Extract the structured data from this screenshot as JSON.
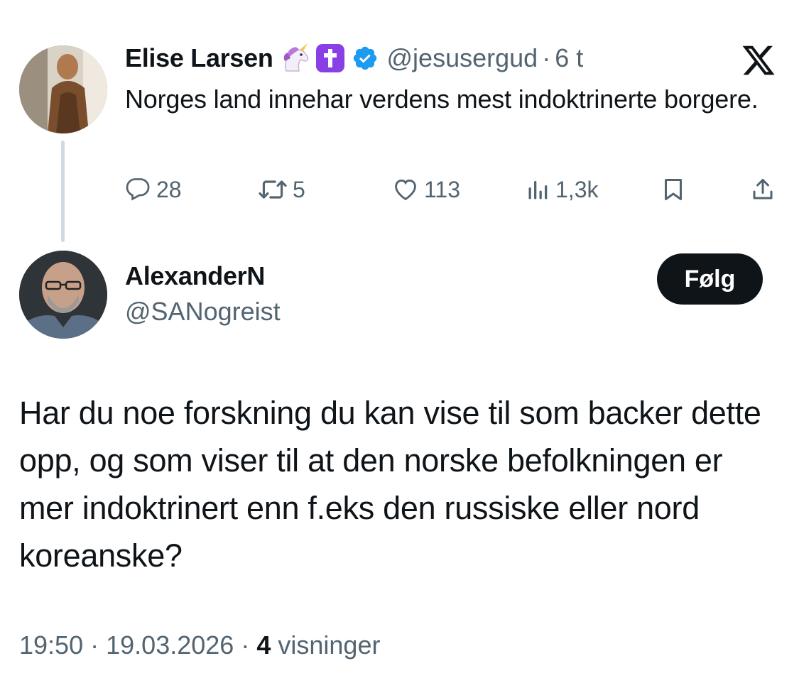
{
  "parent_tweet": {
    "author_name": "Elise Larsen",
    "handle": "@jesusergud",
    "time_ago": "6 t",
    "separator": "·",
    "text": "Norges land innehar verdens mest indoktrinerte borgere.",
    "actions": {
      "replies": "28",
      "retweets": "5",
      "likes": "113",
      "views": "1,3k"
    },
    "badges": [
      "unicorn-emoji",
      "latin-cross-emoji",
      "verified-badge"
    ]
  },
  "reply_tweet": {
    "author_name": "AlexanderN",
    "handle": "@SANogreist",
    "follow_label": "Følg",
    "text": "Har du noe forskning du kan vise til som backer dette opp, og som viser til at den norske befolkningen er mer indoktrinert enn f.eks den russiske eller nord koreanske?",
    "time": "19:50",
    "date": "19.03.2026",
    "views_count": "4",
    "views_label": "visninger",
    "separator": "·"
  },
  "colors": {
    "text_primary": "#0f1419",
    "text_secondary": "#536471",
    "verified_blue": "#1d9bf0",
    "thread_line": "#cfd9de",
    "follow_button_bg": "#0f1419"
  },
  "icons": [
    "x-logo-icon",
    "reply-icon",
    "retweet-icon",
    "like-icon",
    "views-icon",
    "bookmark-icon",
    "share-icon"
  ]
}
